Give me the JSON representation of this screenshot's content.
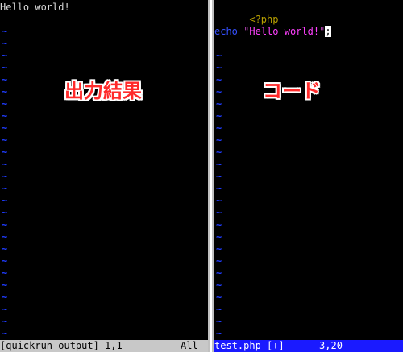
{
  "left_pane": {
    "output_text": "Hello world!",
    "tilde": "~",
    "tilde_count": 26,
    "annotation": "出力結果",
    "status": "[quickrun output] 1,1          All"
  },
  "right_pane": {
    "php_open": "<?php",
    "echo_keyword": "echo",
    "string_quote_open": "\"",
    "string_text": "Hello world!",
    "string_quote_close": "\"",
    "semicolon": ";",
    "tilde": "~",
    "tilde_count": 24,
    "annotation": "コード",
    "status": "test.php [+]      3,20"
  },
  "colors": {
    "background": "#000000",
    "tilde": "#1f3cff",
    "php_tag": "#b8a000",
    "keyword": "#3550ff",
    "string": "#ff40ff",
    "left_status_bg": "#c8c8c8",
    "right_status_bg": "#1a1aff",
    "annotation": "#ff2a2a"
  }
}
